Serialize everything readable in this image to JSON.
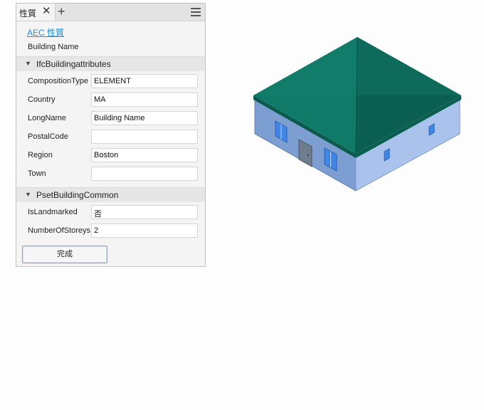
{
  "panel": {
    "tab_label": "性質",
    "close_glyph": "✕",
    "add_glyph": "+",
    "aec_link": "AEC 性質",
    "building_name": "Building Name",
    "sections": [
      {
        "title": "IfcBuildingattributes",
        "rows": [
          {
            "label": "CompositionType",
            "value": "ELEMENT"
          },
          {
            "label": "Country",
            "value": "MA"
          },
          {
            "label": "LongName",
            "value": "Building Name"
          },
          {
            "label": "PostalCode",
            "value": ""
          },
          {
            "label": "Region",
            "value": "Boston"
          },
          {
            "label": "Town",
            "value": ""
          }
        ]
      },
      {
        "title": "PsetBuildingCommon",
        "rows": [
          {
            "label": "IsLandmarked",
            "value": "否"
          },
          {
            "label": "NumberOfStoreys",
            "value": "2"
          }
        ]
      }
    ],
    "done_label": "完成"
  },
  "colors": {
    "accent": "#1a8ed8",
    "roof": "#0d6b5c",
    "wall": "#8fb0e0",
    "window": "#3f86e6"
  }
}
